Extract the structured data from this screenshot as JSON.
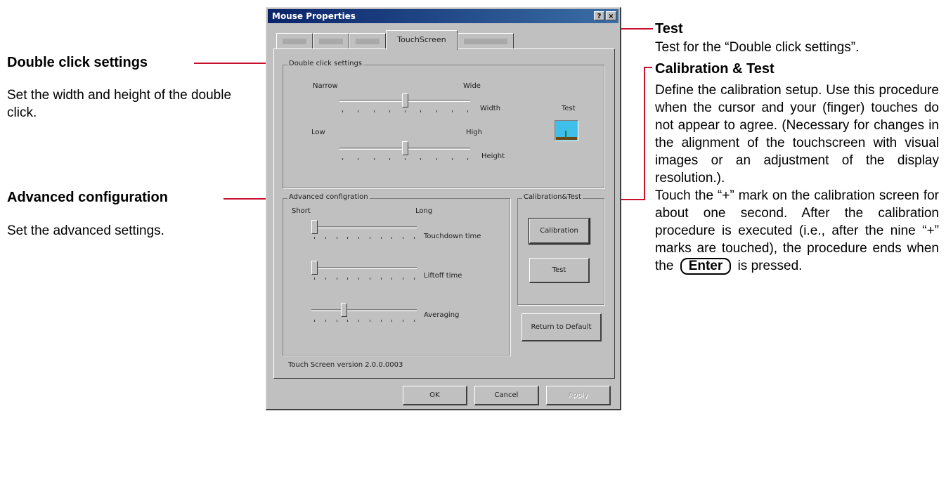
{
  "annotations": {
    "double_click": {
      "title": "Double click settings",
      "description": "Set the width and height of the double click."
    },
    "advanced": {
      "title": "Advanced configuration",
      "description": "Set the advanced settings."
    },
    "test": {
      "title": "Test",
      "description": "Test for the “Double click settings”."
    },
    "calibration": {
      "title": "Calibration & Test",
      "para1": "Define the calibration setup. Use this procedure when the cursor and your (finger) touches do not appear to agree. (Necessary for changes in the alignment of the touchscreen with visual images or an adjustment of the display resolution.).",
      "para2": "Touch the “+” mark on the calibration screen for about one second. After the calibration procedure is executed (i.e., after the nine “+” marks are touched), the procedure ends when the",
      "key": "Enter",
      "para2_end": "is pressed."
    }
  },
  "dialog": {
    "title": "Mouse Properties",
    "help_label": "?",
    "close_label": "×",
    "active_tab": "TouchScreen",
    "double_click_group": {
      "label": "Double click settings",
      "width_min_label": "Narrow",
      "width_max_label": "Wide",
      "width_label": "Width",
      "width_value": 0.5,
      "height_min_label": "Low",
      "height_max_label": "High",
      "height_label": "Height",
      "height_value": 0.5,
      "test_label": "Test"
    },
    "advanced_group": {
      "label": "Advanced configration",
      "min_label": "Short",
      "max_label": "Long",
      "touchdown_label": "Touchdown time",
      "touchdown_value": 0.0,
      "liftoff_label": "Liftoff time",
      "liftoff_value": 0.0,
      "averaging_label": "Averaging",
      "averaging_value": 0.3
    },
    "calibration_group": {
      "label": "Calibration&Test",
      "calibration_button": "Calibration",
      "test_button": "Test"
    },
    "return_default_button": "Return to Default",
    "version_text": "Touch Screen version  2.0.0.0003",
    "ok_button": "OK",
    "cancel_button": "Cancel",
    "apply_button": "Apply"
  }
}
